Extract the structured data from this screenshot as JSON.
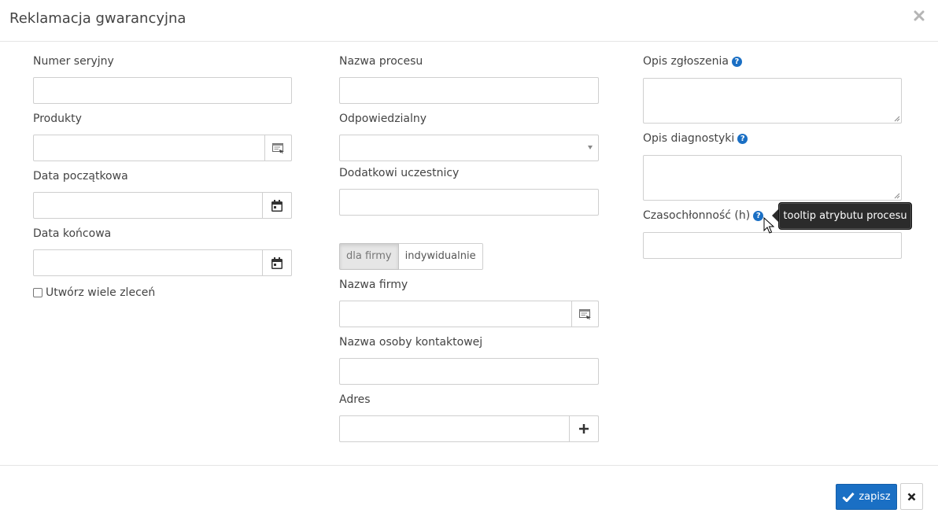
{
  "dialog": {
    "title": "Reklamacja gwarancyjna",
    "close_icon": "close-icon"
  },
  "col1": {
    "serial_label": "Numer seryjny",
    "products_label": "Produkty",
    "start_date_label": "Data początkowa",
    "end_date_label": "Data końcowa",
    "multi_orders_label": "Utwórz wiele zleceń",
    "multi_orders_checked": false
  },
  "col2": {
    "process_name_label": "Nazwa procesu",
    "responsible_label": "Odpowiedzialny",
    "participants_label": "Dodatkowi uczestnicy",
    "toggle": {
      "company": "dla firmy",
      "individual": "indywidualnie",
      "selected": "dla firmy"
    },
    "company_name_label": "Nazwa firmy",
    "contact_name_label": "Nazwa osoby kontaktowej",
    "address_label": "Adres"
  },
  "col3": {
    "report_desc_label": "Opis zgłoszenia",
    "diag_desc_label": "Opis diagnostyki",
    "time_label": "Czasochłonność (h)",
    "tooltip_text": "tooltip atrybutu procesu"
  },
  "footer": {
    "save_label": "zapisz"
  },
  "colors": {
    "accent": "#1a6fc4",
    "tooltip_bg": "#2b2b2b"
  }
}
